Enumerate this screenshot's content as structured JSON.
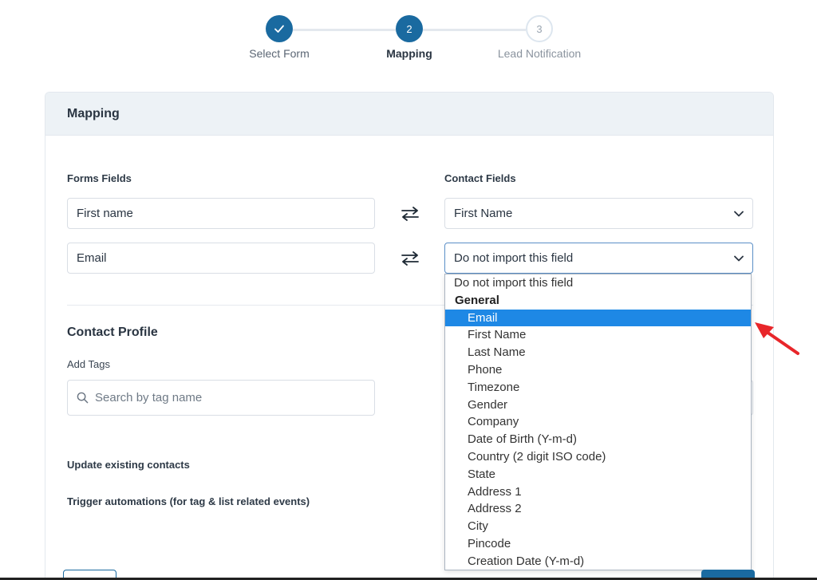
{
  "stepper": {
    "steps": [
      {
        "label": "Select Form",
        "state": "done",
        "icon": "check-icon"
      },
      {
        "label": "Mapping",
        "number": "2",
        "state": "active"
      },
      {
        "label": "Lead Notification",
        "number": "3",
        "state": "todo"
      }
    ]
  },
  "card": {
    "title": "Mapping",
    "forms_fields_label": "Forms Fields",
    "contact_fields_label": "Contact Fields",
    "rows": [
      {
        "form_field": "First name",
        "contact_field": "First Name"
      },
      {
        "form_field": "Email",
        "contact_field": "Do not import this field"
      }
    ],
    "contact_profile": {
      "heading": "Contact Profile",
      "add_tags_label": "Add Tags",
      "tag_search_placeholder": "Search by tag name",
      "update_existing_label": "Update existing contacts",
      "trigger_automations_label": "Trigger automations (for tag & list related events)"
    }
  },
  "dropdown": {
    "none_option": "Do not import this field",
    "group_label": "General",
    "options": [
      "Email",
      "First Name",
      "Last Name",
      "Phone",
      "Timezone",
      "Gender",
      "Company",
      "Date of Birth (Y-m-d)",
      "Country (2 digit ISO code)",
      "State",
      "Address 1",
      "Address 2",
      "City",
      "Pincode",
      "Creation Date (Y-m-d)"
    ],
    "selected": "Email"
  },
  "colors": {
    "accent": "#1a6aa0",
    "highlight": "#1e88e5",
    "arrow": "#e8262a"
  }
}
